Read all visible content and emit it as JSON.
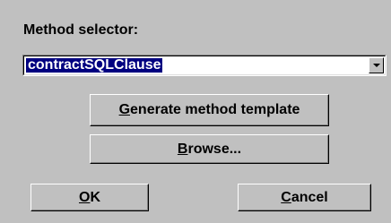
{
  "dialog": {
    "method_label": "Method selector:",
    "method_select": {
      "value": "contractSQLClause",
      "arrow_icon": "chevron-down-icon"
    },
    "buttons": {
      "generate": {
        "mnemonic": "G",
        "rest": "enerate method template"
      },
      "browse": {
        "mnemonic": "B",
        "rest": "rowse..."
      },
      "ok": {
        "mnemonic": "O",
        "rest": "K"
      },
      "cancel": {
        "mnemonic": "C",
        "rest": "ancel"
      }
    }
  },
  "colors": {
    "background": "#c0c0c0",
    "selection_bg": "#000080",
    "selection_fg": "#ffffff"
  }
}
